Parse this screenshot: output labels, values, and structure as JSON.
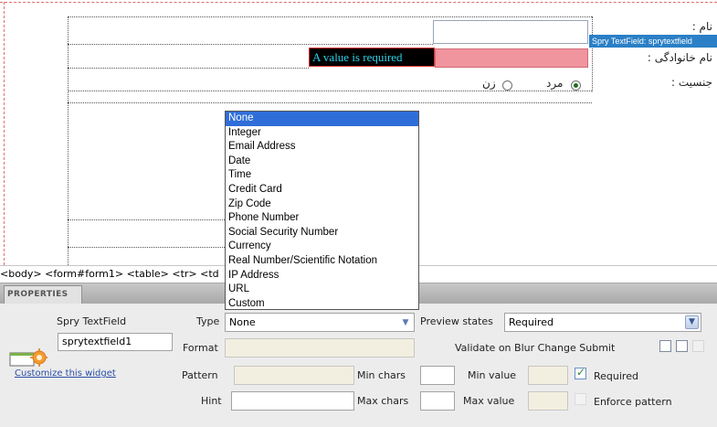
{
  "design": {
    "spry_tag": "Spry TextField: sprytextfield",
    "error_message": "A value is required",
    "labels": {
      "name": "نام :",
      "last_name": "نام خانوادگی :",
      "gender": "جنسیت :"
    },
    "gender_options": [
      {
        "label": "مرد",
        "checked": true
      },
      {
        "label": "زن",
        "checked": false
      }
    ]
  },
  "tag_selector": "<body> <form#form1> <table> <tr> <td",
  "type_options": [
    "None",
    "Integer",
    "Email Address",
    "Date",
    "Time",
    "Credit Card",
    "Zip Code",
    "Phone Number",
    "Social Security Number",
    "Currency",
    "Real Number/Scientific Notation",
    "IP Address",
    "URL",
    "Custom"
  ],
  "type_selected_index": 0,
  "properties": {
    "tab_label": "PROPERTIES",
    "widget_title": "Spry TextField",
    "widget_id": "sprytextfield1",
    "customize_link": "Customize this widget",
    "type_label": "Type",
    "type_value": "None",
    "preview_label": "Preview states",
    "preview_value": "Required",
    "format_label": "Format",
    "validate_label": "Validate on",
    "blur_label": "Blur",
    "change_label": "Change",
    "submit_label": "Submit",
    "pattern_label": "Pattern",
    "min_chars_label": "Min chars",
    "min_value_label": "Min value",
    "required_label": "Required",
    "hint_label": "Hint",
    "max_chars_label": "Max chars",
    "max_value_label": "Max value",
    "enforce_label": "Enforce pattern",
    "required_checked": true,
    "blur_checked": false,
    "change_checked": false,
    "submit_checked": false
  }
}
